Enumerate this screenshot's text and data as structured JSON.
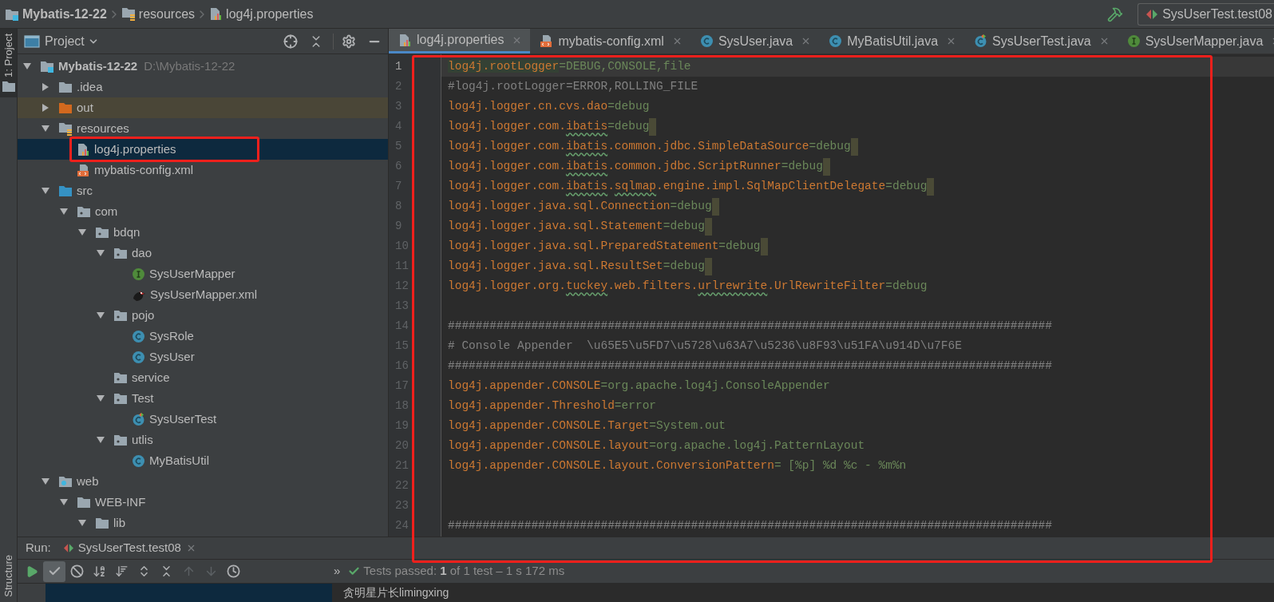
{
  "breadcrumb": [
    {
      "label": "Mybatis-12-22",
      "kind": "module",
      "bold": true
    },
    {
      "label": "resources",
      "kind": "resources",
      "bold": false
    },
    {
      "label": "log4j.properties",
      "kind": "properties",
      "bold": false
    }
  ],
  "run_config": {
    "label": "SysUserTest.test08"
  },
  "side_tabs": {
    "top": "1: Project",
    "bottom": "Structure"
  },
  "project_panel": {
    "title": "Project",
    "tree": [
      {
        "label": "Mybatis-12-22",
        "hint": "D:\\Mybatis-12-22",
        "kind": "module",
        "expanded": true,
        "selected": false,
        "excluded": false,
        "outlined": false,
        "children": [
          {
            "label": ".idea",
            "kind": "folder",
            "expanded": false,
            "selected": false,
            "excluded": false,
            "outlined": false
          },
          {
            "label": "out",
            "kind": "folder-orange",
            "expanded": false,
            "selected": false,
            "excluded": true,
            "outlined": false
          },
          {
            "label": "resources",
            "kind": "resources",
            "expanded": true,
            "selected": false,
            "excluded": false,
            "outlined": false,
            "children": [
              {
                "label": "log4j.properties",
                "kind": "properties",
                "selected": true,
                "excluded": false,
                "outlined": true
              },
              {
                "label": "mybatis-config.xml",
                "kind": "xml",
                "selected": false,
                "excluded": false,
                "outlined": false
              }
            ]
          },
          {
            "label": "src",
            "kind": "source",
            "expanded": true,
            "selected": false,
            "excluded": false,
            "outlined": false,
            "children": [
              {
                "label": "com",
                "kind": "package",
                "expanded": true,
                "selected": false,
                "excluded": false,
                "outlined": false,
                "children": [
                  {
                    "label": "bdqn",
                    "kind": "package",
                    "expanded": true,
                    "selected": false,
                    "excluded": false,
                    "outlined": false,
                    "children": [
                      {
                        "label": "dao",
                        "kind": "package",
                        "expanded": true,
                        "selected": false,
                        "excluded": false,
                        "outlined": false,
                        "children": [
                          {
                            "label": "SysUserMapper",
                            "kind": "interface",
                            "selected": false,
                            "excluded": false,
                            "outlined": false
                          },
                          {
                            "label": "SysUserMapper.xml",
                            "kind": "bird",
                            "selected": false,
                            "excluded": false,
                            "outlined": false
                          }
                        ]
                      },
                      {
                        "label": "pojo",
                        "kind": "package",
                        "expanded": true,
                        "selected": false,
                        "excluded": false,
                        "outlined": false,
                        "children": [
                          {
                            "label": "SysRole",
                            "kind": "class",
                            "selected": false,
                            "excluded": false,
                            "outlined": false
                          },
                          {
                            "label": "SysUser",
                            "kind": "class",
                            "selected": false,
                            "excluded": false,
                            "outlined": false
                          }
                        ]
                      },
                      {
                        "label": "service",
                        "kind": "package",
                        "selected": false,
                        "excluded": false,
                        "outlined": false
                      },
                      {
                        "label": "Test",
                        "kind": "package",
                        "expanded": true,
                        "selected": false,
                        "excluded": false,
                        "outlined": false,
                        "children": [
                          {
                            "label": "SysUserTest",
                            "kind": "test-class",
                            "selected": false,
                            "excluded": false,
                            "outlined": false
                          }
                        ]
                      },
                      {
                        "label": "utlis",
                        "kind": "package",
                        "expanded": true,
                        "selected": false,
                        "excluded": false,
                        "outlined": false,
                        "children": [
                          {
                            "label": "MyBatisUtil",
                            "kind": "class",
                            "selected": false,
                            "excluded": false,
                            "outlined": false
                          }
                        ]
                      }
                    ]
                  }
                ]
              }
            ]
          },
          {
            "label": "web",
            "kind": "web",
            "expanded": true,
            "selected": false,
            "excluded": false,
            "outlined": false,
            "children": [
              {
                "label": "WEB-INF",
                "kind": "folder",
                "expanded": true,
                "selected": false,
                "excluded": false,
                "outlined": false,
                "children": [
                  {
                    "label": "lib",
                    "kind": "folder",
                    "expanded": true,
                    "selected": false,
                    "excluded": false,
                    "outlined": false
                  }
                ]
              }
            ]
          }
        ]
      }
    ]
  },
  "editor": {
    "outlined": true,
    "tabs": [
      {
        "label": "log4j.properties",
        "kind": "properties",
        "selected": true
      },
      {
        "label": "mybatis-config.xml",
        "kind": "xml",
        "selected": false
      },
      {
        "label": "SysUser.java",
        "kind": "class",
        "selected": false
      },
      {
        "label": "MyBatisUtil.java",
        "kind": "class",
        "selected": false
      },
      {
        "label": "SysUserTest.java",
        "kind": "test-class",
        "selected": false
      },
      {
        "label": "SysUserMapper.java",
        "kind": "interface",
        "selected": false
      }
    ],
    "lines": [
      {
        "number": "1",
        "current": true,
        "trailing_mark": false,
        "segments": [
          {
            "text": "log4j.rootLogger",
            "kind": "key-hl"
          },
          {
            "text": "=DEBUG,CONSOLE,file",
            "kind": "value"
          }
        ]
      },
      {
        "number": "2",
        "current": false,
        "trailing_mark": false,
        "segments": [
          {
            "text": "#log4j.rootLogger=ERROR,ROLLING_FILE",
            "kind": "comment"
          }
        ]
      },
      {
        "number": "3",
        "current": false,
        "trailing_mark": false,
        "segments": [
          {
            "text": "log4j.logger.cn.cvs.dao",
            "kind": "key"
          },
          {
            "text": "=debug",
            "kind": "value"
          }
        ]
      },
      {
        "number": "4",
        "current": false,
        "trailing_mark": true,
        "segments": [
          {
            "text": "log4j.logger.com.",
            "kind": "key"
          },
          {
            "text": "ibatis",
            "kind": "key-typo"
          },
          {
            "text": "=debug",
            "kind": "value"
          }
        ]
      },
      {
        "number": "5",
        "current": false,
        "trailing_mark": true,
        "segments": [
          {
            "text": "log4j.logger.com.",
            "kind": "key"
          },
          {
            "text": "ibatis",
            "kind": "key-typo"
          },
          {
            "text": ".common.jdbc.SimpleDataSource",
            "kind": "key"
          },
          {
            "text": "=debug",
            "kind": "value"
          }
        ]
      },
      {
        "number": "6",
        "current": false,
        "trailing_mark": true,
        "segments": [
          {
            "text": "log4j.logger.com.",
            "kind": "key"
          },
          {
            "text": "ibatis",
            "kind": "key-typo"
          },
          {
            "text": ".common.jdbc.ScriptRunner",
            "kind": "key"
          },
          {
            "text": "=debug",
            "kind": "value"
          }
        ]
      },
      {
        "number": "7",
        "current": false,
        "trailing_mark": true,
        "segments": [
          {
            "text": "log4j.logger.com.",
            "kind": "key"
          },
          {
            "text": "ibatis",
            "kind": "key-typo"
          },
          {
            "text": ".",
            "kind": "key"
          },
          {
            "text": "sqlmap",
            "kind": "key-typo"
          },
          {
            "text": ".engine.impl.SqlMapClientDelegate",
            "kind": "key"
          },
          {
            "text": "=debug",
            "kind": "value"
          }
        ]
      },
      {
        "number": "8",
        "current": false,
        "trailing_mark": true,
        "segments": [
          {
            "text": "log4j.logger.java.sql.Connection",
            "kind": "key"
          },
          {
            "text": "=debug",
            "kind": "value"
          }
        ]
      },
      {
        "number": "9",
        "current": false,
        "trailing_mark": true,
        "segments": [
          {
            "text": "log4j.logger.java.sql.Statement",
            "kind": "key"
          },
          {
            "text": "=debug",
            "kind": "value"
          }
        ]
      },
      {
        "number": "10",
        "current": false,
        "trailing_mark": true,
        "segments": [
          {
            "text": "log4j.logger.java.sql.PreparedStatement",
            "kind": "key"
          },
          {
            "text": "=debug",
            "kind": "value"
          }
        ]
      },
      {
        "number": "11",
        "current": false,
        "trailing_mark": true,
        "segments": [
          {
            "text": "log4j.logger.java.sql.ResultSet",
            "kind": "key"
          },
          {
            "text": "=debug",
            "kind": "value"
          }
        ]
      },
      {
        "number": "12",
        "current": false,
        "trailing_mark": false,
        "segments": [
          {
            "text": "log4j.logger.org.",
            "kind": "key"
          },
          {
            "text": "tuckey",
            "kind": "key-typo"
          },
          {
            "text": ".web.filters.",
            "kind": "key"
          },
          {
            "text": "urlrewrite",
            "kind": "key-typo"
          },
          {
            "text": ".UrlRewriteFilter",
            "kind": "key"
          },
          {
            "text": "=debug",
            "kind": "value"
          }
        ]
      },
      {
        "number": "13",
        "current": false,
        "trailing_mark": false
      },
      {
        "number": "14",
        "current": false,
        "trailing_mark": false,
        "segments": [
          {
            "text": "#######################################################################################",
            "kind": "comment"
          }
        ]
      },
      {
        "number": "15",
        "current": false,
        "trailing_mark": false,
        "segments": [
          {
            "text": "# Console Appender  \\u65E5\\u5FD7\\u5728\\u63A7\\u5236\\u8F93\\u51FA\\u914D\\u7F6E",
            "kind": "comment"
          }
        ]
      },
      {
        "number": "16",
        "current": false,
        "trailing_mark": false,
        "segments": [
          {
            "text": "#######################################################################################",
            "kind": "comment"
          }
        ]
      },
      {
        "number": "17",
        "current": false,
        "trailing_mark": false,
        "segments": [
          {
            "text": "log4j.appender.CONSOLE",
            "kind": "key"
          },
          {
            "text": "=org.apache.log4j.ConsoleAppender",
            "kind": "value"
          }
        ]
      },
      {
        "number": "18",
        "current": false,
        "trailing_mark": false,
        "segments": [
          {
            "text": "log4j.appender.Threshold",
            "kind": "key"
          },
          {
            "text": "=error",
            "kind": "value"
          }
        ]
      },
      {
        "number": "19",
        "current": false,
        "trailing_mark": false,
        "segments": [
          {
            "text": "log4j.appender.CONSOLE.Target",
            "kind": "key"
          },
          {
            "text": "=System.out",
            "kind": "value"
          }
        ]
      },
      {
        "number": "20",
        "current": false,
        "trailing_mark": false,
        "segments": [
          {
            "text": "log4j.appender.CONSOLE.layout",
            "kind": "key"
          },
          {
            "text": "=org.apache.log4j.PatternLayout",
            "kind": "value"
          }
        ]
      },
      {
        "number": "21",
        "current": false,
        "trailing_mark": false,
        "segments": [
          {
            "text": "log4j.appender.CONSOLE.layout.ConversionPattern",
            "kind": "key"
          },
          {
            "text": "= [%p] %d %c - %m%n",
            "kind": "value"
          }
        ]
      },
      {
        "number": "22",
        "current": false,
        "trailing_mark": false
      },
      {
        "number": "23",
        "current": false,
        "trailing_mark": false
      },
      {
        "number": "24",
        "current": false,
        "trailing_mark": false,
        "segments": [
          {
            "text": "#######################################################################################",
            "kind": "comment"
          }
        ]
      }
    ]
  },
  "run": {
    "label": "Run:",
    "tab": "SysUserTest.test08",
    "toolbar": [
      {
        "kind": "play",
        "on": false,
        "disabled": false
      },
      {
        "kind": "check",
        "on": true,
        "disabled": false
      },
      {
        "kind": "ignored",
        "on": false,
        "disabled": false
      },
      {
        "kind": "sort-alpha",
        "on": false,
        "disabled": false
      },
      {
        "kind": "sort-duration",
        "on": false,
        "disabled": false
      },
      {
        "kind": "expand",
        "on": false,
        "disabled": false
      },
      {
        "kind": "collapse",
        "on": false,
        "disabled": false
      },
      {
        "kind": "up",
        "on": false,
        "disabled": true
      },
      {
        "kind": "down",
        "on": false,
        "disabled": true
      },
      {
        "kind": "history",
        "on": false,
        "disabled": false
      }
    ],
    "more": "»",
    "status": "Tests passed: **1** of 1 test – 1 s 172 ms",
    "output": "贪明星片长limingxing"
  }
}
